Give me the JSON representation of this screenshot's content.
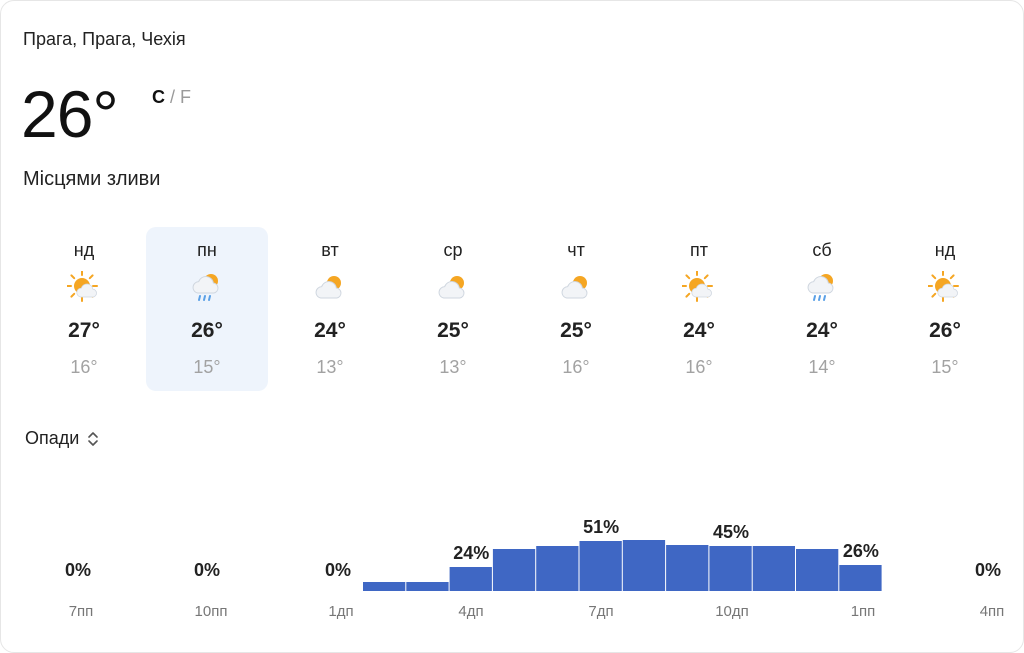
{
  "location": "Прага, Прага, Чехія",
  "current": {
    "temp": "26°",
    "unit_c": "C",
    "unit_sep": "/",
    "unit_f": "F",
    "condition": "Місцями зливи"
  },
  "days": [
    {
      "name": "нд",
      "icon": "sun-cloud-icon",
      "hi": "27°",
      "lo": "16°"
    },
    {
      "name": "пн",
      "icon": "cloud-rain-sun-icon",
      "hi": "26°",
      "lo": "15°"
    },
    {
      "name": "вт",
      "icon": "cloud-sun-icon",
      "hi": "24°",
      "lo": "13°"
    },
    {
      "name": "ср",
      "icon": "cloud-sun-icon",
      "hi": "25°",
      "lo": "13°"
    },
    {
      "name": "чт",
      "icon": "cloud-sun-icon",
      "hi": "25°",
      "lo": "16°"
    },
    {
      "name": "пт",
      "icon": "sun-cloud-icon",
      "hi": "24°",
      "lo": "16°"
    },
    {
      "name": "сб",
      "icon": "cloud-rain-sun-icon",
      "hi": "24°",
      "lo": "14°"
    },
    {
      "name": "нд",
      "icon": "sun-cloud-icon",
      "hi": "26°",
      "lo": "15°"
    }
  ],
  "metric": {
    "label": "Опади"
  },
  "colors": {
    "bar": "#3f67c4",
    "selected_bg": "#eef4fc",
    "sun": "#f5a623"
  },
  "chart_data": {
    "type": "bar",
    "title": "",
    "x_tick_labels": [
      "7пп",
      "10пп",
      "1дп",
      "4дп",
      "7дп",
      "10дп",
      "1пп",
      "4пп"
    ],
    "zero_labels": [
      "0%",
      "0%",
      "0%",
      "0%"
    ],
    "bar_values": [
      9,
      9,
      24,
      42,
      45,
      50,
      51,
      46,
      45,
      45,
      42,
      26
    ],
    "bar_data_labels": [
      {
        "index": 2,
        "text": "24%"
      },
      {
        "index": 5,
        "text": "51%"
      },
      {
        "index": 8,
        "text": "45%"
      },
      {
        "index": 11,
        "text": "26%"
      }
    ],
    "ylim": [
      0,
      100
    ]
  }
}
